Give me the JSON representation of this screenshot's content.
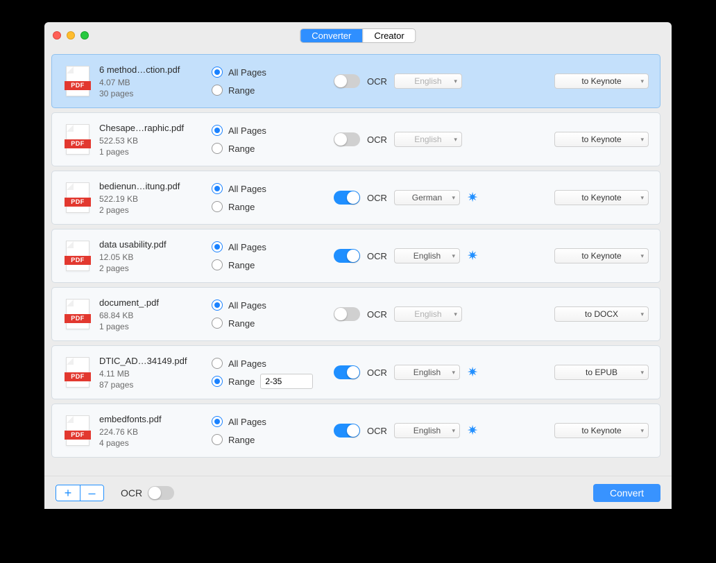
{
  "pdf_band": "PDF",
  "segmented": {
    "converter": "Converter",
    "creator": "Creator"
  },
  "labels": {
    "all_pages": "All Pages",
    "range": "Range",
    "ocr": "OCR"
  },
  "footer": {
    "ocr_label": "OCR",
    "add_symbol": "+",
    "remove_symbol": "–",
    "convert": "Convert"
  },
  "files": [
    {
      "name": "6 method…ction.pdf",
      "size": "4.07 MB",
      "pages": "30 pages",
      "page_mode": "all",
      "range_value": "",
      "ocr_on": false,
      "language": "English",
      "show_gear": false,
      "output": "to Keynote",
      "selected": true
    },
    {
      "name": "Chesape…raphic.pdf",
      "size": "522.53 KB",
      "pages": "1 pages",
      "page_mode": "all",
      "range_value": "",
      "ocr_on": false,
      "language": "English",
      "show_gear": false,
      "output": "to Keynote",
      "selected": false
    },
    {
      "name": "bedienun…itung.pdf",
      "size": "522.19 KB",
      "pages": "2 pages",
      "page_mode": "all",
      "range_value": "",
      "ocr_on": true,
      "language": "German",
      "show_gear": true,
      "output": "to Keynote",
      "selected": false
    },
    {
      "name": "data usability.pdf",
      "size": "12.05 KB",
      "pages": "2 pages",
      "page_mode": "all",
      "range_value": "",
      "ocr_on": true,
      "language": "English",
      "show_gear": true,
      "output": "to Keynote",
      "selected": false
    },
    {
      "name": "document_.pdf",
      "size": "68.84 KB",
      "pages": "1 pages",
      "page_mode": "all",
      "range_value": "",
      "ocr_on": false,
      "language": "English",
      "show_gear": false,
      "output": "to DOCX",
      "selected": false
    },
    {
      "name": "DTIC_AD…34149.pdf",
      "size": "4.11 MB",
      "pages": "87 pages",
      "page_mode": "range",
      "range_value": "2-35",
      "ocr_on": true,
      "language": "English",
      "show_gear": true,
      "output": "to EPUB",
      "selected": false
    },
    {
      "name": "embedfonts.pdf",
      "size": "224.76 KB",
      "pages": "4 pages",
      "page_mode": "all",
      "range_value": "",
      "ocr_on": true,
      "language": "English",
      "show_gear": true,
      "output": "to Keynote",
      "selected": false
    }
  ]
}
